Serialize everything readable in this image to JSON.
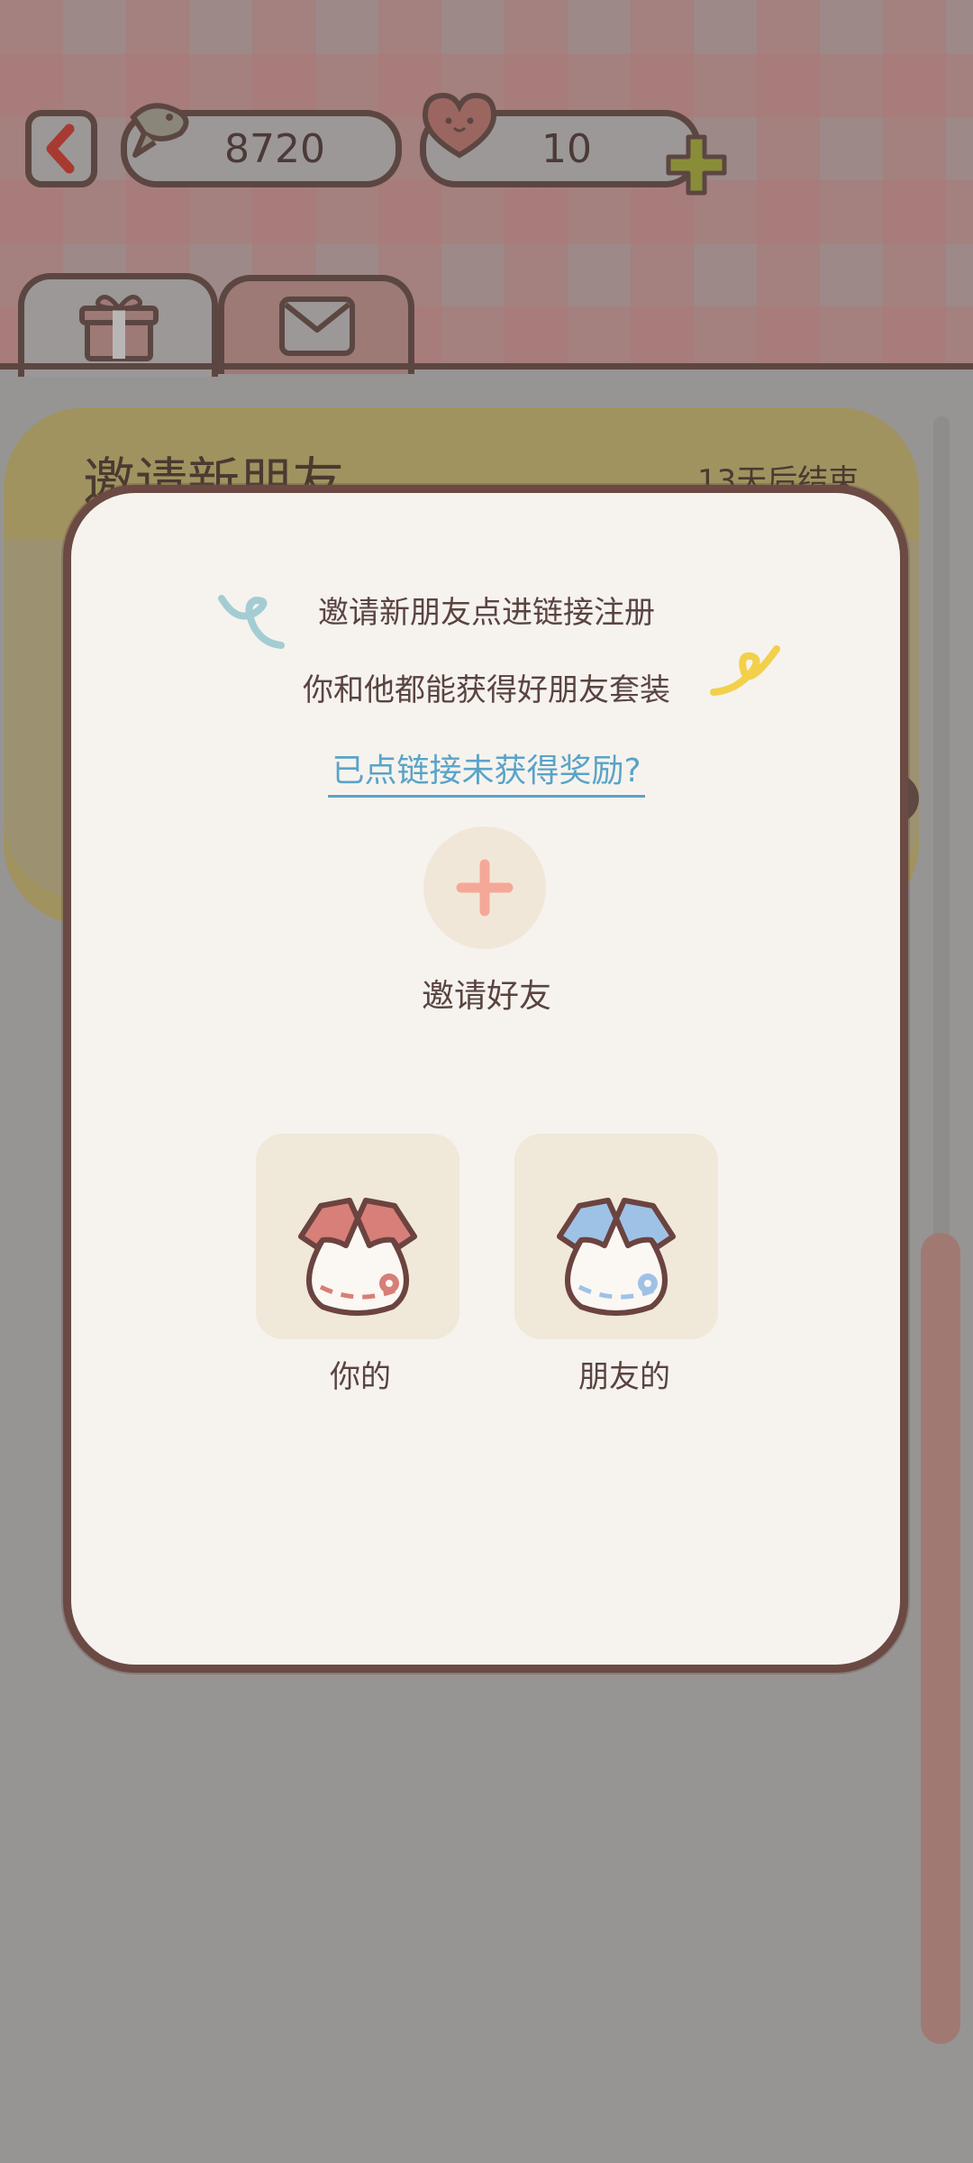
{
  "header": {
    "fish_count": "8720",
    "heart_count": "10"
  },
  "tabs": [
    {
      "name": "gift-tab",
      "icon": "gift-icon"
    },
    {
      "name": "mail-tab",
      "icon": "mail-icon"
    }
  ],
  "event": {
    "title": "邀请新朋友",
    "timer": "13天后结束"
  },
  "modal": {
    "line1": "邀请新朋友点进链接注册",
    "line2": "你和他都能获得好朋友套装",
    "link": "已点链接未获得奖励?",
    "invite_label": "邀请好友",
    "reward_mine": "你的",
    "reward_friend": "朋友的"
  },
  "colors": {
    "accent_pink": "#f2a89a",
    "link_blue": "#5aa3c8",
    "border_brown": "#6b4a44",
    "outfit_pink": "#d77f78",
    "outfit_blue": "#9ec2e6"
  }
}
